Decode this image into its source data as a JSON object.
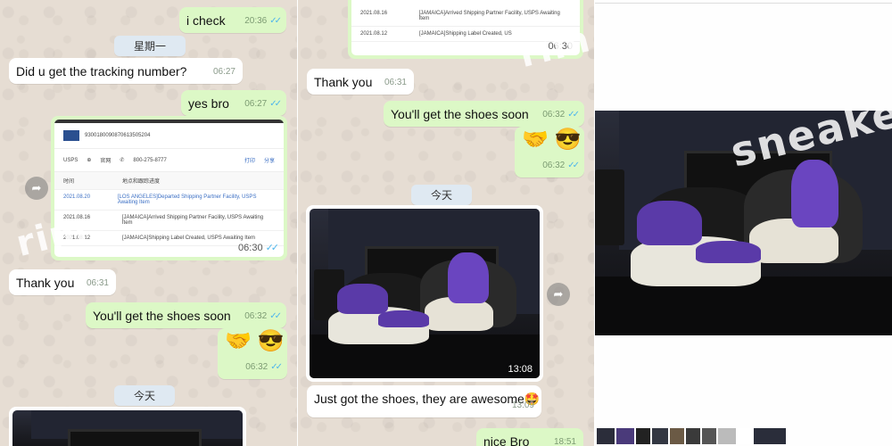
{
  "colors": {
    "outgoing_bubble": "#dcf8c6",
    "incoming_bubble": "#ffffff",
    "read_ticks": "#4fb6ec",
    "date_chip": "#dfe9f2"
  },
  "panel_a": {
    "msg_i_check": {
      "text": "i check",
      "time": "20:36"
    },
    "day1": "星期一",
    "msg_tracking_q": {
      "text": "Did u get the tracking number?",
      "time": "06:27"
    },
    "msg_yes_bro": {
      "text": "yes bro",
      "time": "06:27"
    },
    "tracking_image": {
      "time": "06:30",
      "tracking_number": "9300180090870613505204",
      "carrier": "USPS",
      "site": "官网",
      "phone": "800-275-8777",
      "actions": [
        "打印",
        "分享"
      ],
      "col_time": "时间",
      "col_status": "地点和跟踪进度",
      "events": [
        {
          "date": "2021.08.20",
          "text": "[LOS ANGELES]Departed Shipping Partner Facility, USPS Awaiting Item"
        },
        {
          "date": "2021.08.16",
          "text": "[JAMAICA]Arrived Shipping Partner Facility, USPS Awaiting Item"
        },
        {
          "date": "2021.08.12",
          "text": "[JAMAICA]Shipping Label Created, USPS Awaiting Item"
        }
      ]
    },
    "msg_thank_you": {
      "text": "Thank you",
      "time": "06:31"
    },
    "msg_get_shoes": {
      "text": "You'll get the shoes soon",
      "time": "06:32"
    },
    "msg_emoji": {
      "text": "🤝 😎",
      "time": "06:32"
    },
    "day2": "今天"
  },
  "panel_b": {
    "tracking_tail": {
      "events": [
        {
          "date": "2021.08.16",
          "text": "[JAMAICA]Arrived Shipping Partner Facility, USPS Awaiting Item"
        },
        {
          "date": "2021.08.12",
          "text": "[JAMAICA]Shipping Label Created, US"
        }
      ],
      "time": "06:30"
    },
    "msg_thank_you": {
      "text": "Thank you",
      "time": "06:31"
    },
    "msg_get_shoes": {
      "text": "You'll get the shoes soon",
      "time": "06:32"
    },
    "msg_emoji": {
      "text": "🤝 😎",
      "time": "06:32"
    },
    "day": "今天",
    "photo_time": "13:08",
    "msg_awesome": {
      "text": "Just got the shoes, they are awesome🤩",
      "time": "13:09"
    },
    "msg_nice": {
      "text": "nice Bro",
      "time": "18:51"
    }
  },
  "panel_c": {
    "watermark": "sneaker"
  },
  "watermarks": {
    "left": "rim",
    "mid": "rim"
  }
}
